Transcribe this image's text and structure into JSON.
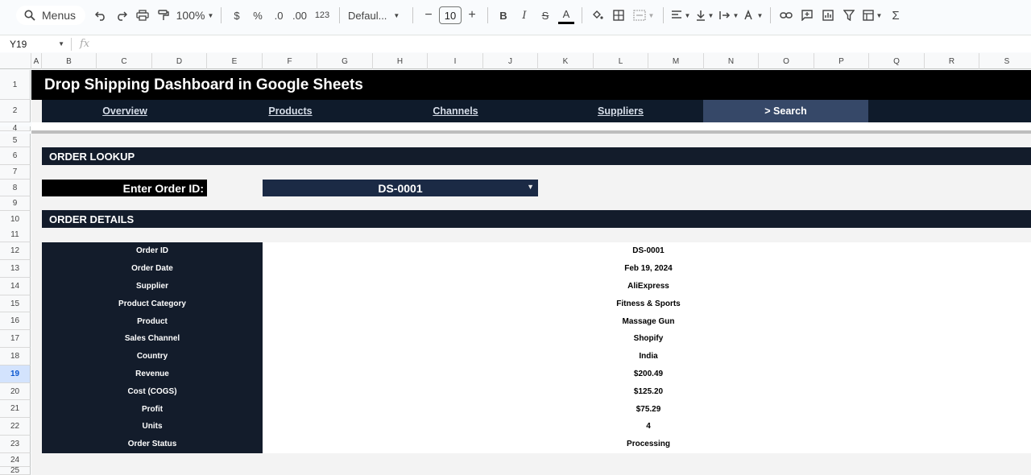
{
  "toolbar": {
    "menus_label": "Menus",
    "zoom": "100%",
    "currency": "$",
    "percent": "%",
    "decimal_decrease": ".0",
    "decimal_increase": ".00",
    "number_format": "123",
    "font_name": "Defaul...",
    "font_size": "10",
    "bold": "B",
    "italic": "I",
    "strike": "S",
    "text_color": "A",
    "minus": "−",
    "plus": "+",
    "sigma": "Σ"
  },
  "formula_bar": {
    "cell_ref": "Y19",
    "fx": "fx"
  },
  "columns": [
    "A",
    "B",
    "C",
    "D",
    "E",
    "F",
    "G",
    "H",
    "I",
    "J",
    "K",
    "L",
    "M",
    "N",
    "O",
    "P",
    "Q",
    "R",
    "S"
  ],
  "rows": [
    "1",
    "2",
    "4",
    "5",
    "6",
    "7",
    "8",
    "9",
    "10",
    "11",
    "12",
    "13",
    "14",
    "15",
    "16",
    "17",
    "18",
    "19",
    "20",
    "21",
    "22",
    "23",
    "24",
    "25"
  ],
  "active_row": "19",
  "sheet": {
    "title": "Drop Shipping Dashboard in Google Sheets",
    "nav": [
      {
        "label": "Overview"
      },
      {
        "label": "Products"
      },
      {
        "label": "Channels"
      },
      {
        "label": "Suppliers"
      },
      {
        "label": "> Search"
      }
    ],
    "order_lookup_header": "ORDER LOOKUP",
    "order_id_label": "Enter Order ID:",
    "order_id_value": "DS-0001",
    "order_details_header": "ORDER DETAILS",
    "details": [
      {
        "label": "Order ID",
        "value": "DS-0001"
      },
      {
        "label": "Order Date",
        "value": "Feb 19, 2024"
      },
      {
        "label": "Supplier",
        "value": "AliExpress"
      },
      {
        "label": "Product Category",
        "value": "Fitness & Sports"
      },
      {
        "label": "Product",
        "value": "Massage Gun"
      },
      {
        "label": "Sales Channel",
        "value": "Shopify"
      },
      {
        "label": "Country",
        "value": "India"
      },
      {
        "label": "Revenue",
        "value": "$200.49"
      },
      {
        "label": "Cost (COGS)",
        "value": "$125.20"
      },
      {
        "label": "Profit",
        "value": "$75.29"
      },
      {
        "label": "Units",
        "value": "4"
      },
      {
        "label": "Order Status",
        "value": "Processing"
      }
    ]
  },
  "colors": {
    "title_bg": "#000000",
    "nav_bg": "#0f1b2b",
    "nav_active_bg": "#364868",
    "section_bg": "#131c2b",
    "select_bg": "#1b2a45"
  }
}
